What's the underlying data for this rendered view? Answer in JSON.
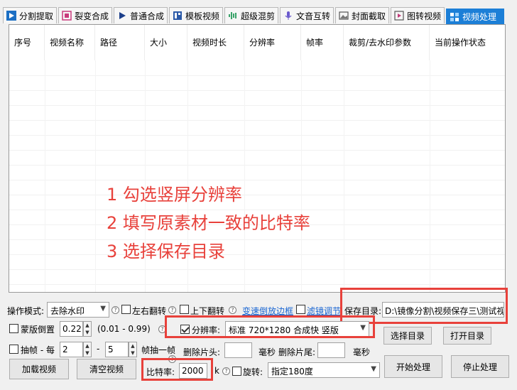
{
  "tabs": [
    {
      "label": "分割提取",
      "icon": "play-icon"
    },
    {
      "label": "裂变合成",
      "icon": "split-icon"
    },
    {
      "label": "普通合成",
      "icon": "arrow-icon"
    },
    {
      "label": "模板视频",
      "icon": "grid-icon"
    },
    {
      "label": "超级混剪",
      "icon": "waveform-icon"
    },
    {
      "label": "文音互转",
      "icon": "microphone-icon"
    },
    {
      "label": "封面截取",
      "icon": "image-icon"
    },
    {
      "label": "图转视频",
      "icon": "slideshow-icon"
    },
    {
      "label": "视频处理",
      "icon": "video-process-icon"
    }
  ],
  "table": {
    "columns": [
      "序号",
      "视频名称",
      "路径",
      "大小",
      "视频时长",
      "分辨率",
      "帧率",
      "裁剪/去水印参数",
      "当前操作状态"
    ]
  },
  "instructions": {
    "line1": "1 勾选竖屏分辨率",
    "line2": "2 填写原素材一致的比特率",
    "line3": "3 选择保存目录"
  },
  "controls": {
    "mode_label": "操作模式:",
    "mode_value": "去除水印",
    "flip_lr": "左右翻转",
    "flip_ud": "上下翻转",
    "speed_link": "变速倒放边框",
    "filter_link": "滤镜调节",
    "save_dir_label": "保存目录:",
    "save_dir_value": "D:\\镜像分割\\视频保存三\\测试视",
    "mask_invert": "蒙版倒置",
    "mask_value": "0.22",
    "mask_range": "(0.01 - 0.99)",
    "resolution_label": "分辨率:",
    "resolution_value": "标准 720*1280 合成快 竖版",
    "choose_dir": "选择目录",
    "open_dir": "打开目录",
    "drop_frame": "抽帧 - 每",
    "drop_a": "2",
    "dash": "-",
    "drop_b": "5",
    "drop_suffix": "帧抽一帧",
    "del_head_label": "删除片头:",
    "del_head_value": "",
    "del_tail_unit1": "毫秒",
    "del_tail_label": "删除片尾:",
    "del_tail_value": "",
    "del_tail_unit2": "毫秒",
    "load_video": "加载视频",
    "clear_video": "清空视频",
    "bitrate_label": "比特率:",
    "bitrate_value": "2000",
    "bitrate_unit": "k",
    "rotate_label": "旋转:",
    "rotate_value": "指定180度",
    "start": "开始处理",
    "stop": "停止处理"
  },
  "colors": {
    "highlight": "#e8413b",
    "active_tab": "#1c7fd7",
    "link": "#1a66d2"
  }
}
